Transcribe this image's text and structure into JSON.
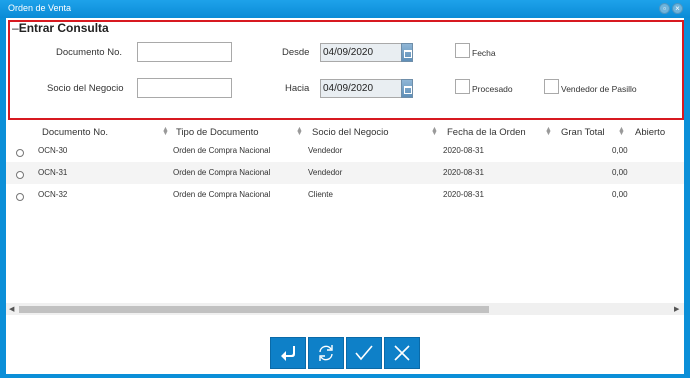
{
  "window": {
    "title": "Orden de Venta",
    "maximize_icon": "maximize-icon",
    "close_icon": "close-icon"
  },
  "query": {
    "dash": "–",
    "title": "Entrar Consulta",
    "documento_label": "Documento No.",
    "documento_value": "",
    "socio_label": "Socio del Negocio",
    "socio_value": "",
    "desde_label": "Desde",
    "desde_value": "04/09/2020",
    "hacia_label": "Hacia",
    "hacia_value": "04/09/2020",
    "fecha_label": "Fecha",
    "procesado_label": "Procesado",
    "vendedor_label": "Vendedor de Pasillo"
  },
  "grid": {
    "columns": [
      "Documento No.",
      "Tipo de Documento",
      "Socio del Negocio",
      "Fecha de la Orden",
      "Gran Total",
      "Abierto"
    ],
    "rows": [
      {
        "doc": "OCN-30",
        "tipo": "Orden de Compra Nacional",
        "socio": "Vendedor",
        "fecha": "2020-08-31",
        "total": "0,00"
      },
      {
        "doc": "OCN-31",
        "tipo": "Orden de Compra Nacional",
        "socio": "Vendedor",
        "fecha": "2020-08-31",
        "total": "0,00"
      },
      {
        "doc": "OCN-32",
        "tipo": "Orden de Compra Nacional",
        "socio": "Cliente",
        "fecha": "2020-08-31",
        "total": "0,00"
      }
    ]
  },
  "actions": {
    "icons": [
      "back-arrow-icon",
      "refresh-icon",
      "ok-check-icon",
      "cancel-x-icon"
    ]
  },
  "colors": {
    "window_blue": "#0b8fd8",
    "highlight_border": "#d71920",
    "button_blue": "#0e80c8"
  }
}
